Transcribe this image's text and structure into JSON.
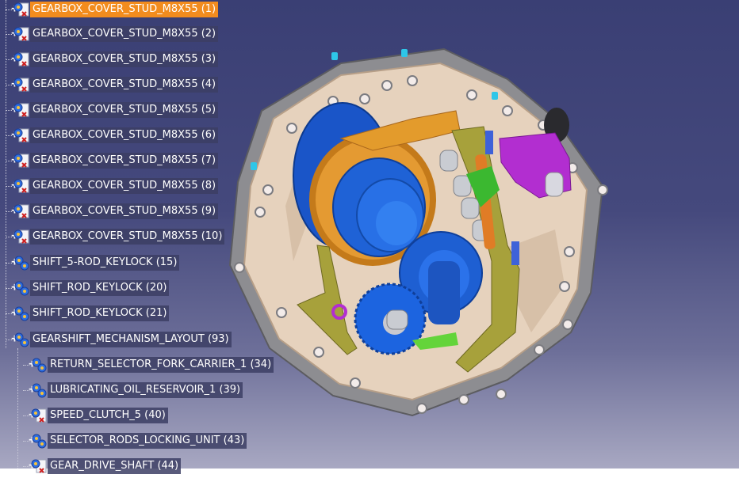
{
  "tree": {
    "items": [
      {
        "label": "GEARBOX_COVER_STUD_M8X55 (1)",
        "icon": "part-icon",
        "selected": true
      },
      {
        "label": "GEARBOX_COVER_STUD_M8X55 (2)",
        "icon": "part-icon"
      },
      {
        "label": "GEARBOX_COVER_STUD_M8X55 (3)",
        "icon": "part-icon"
      },
      {
        "label": "GEARBOX_COVER_STUD_M8X55 (4)",
        "icon": "part-icon"
      },
      {
        "label": "GEARBOX_COVER_STUD_M8X55 (5)",
        "icon": "part-icon"
      },
      {
        "label": "GEARBOX_COVER_STUD_M8X55 (6)",
        "icon": "part-icon"
      },
      {
        "label": "GEARBOX_COVER_STUD_M8X55 (7)",
        "icon": "part-icon"
      },
      {
        "label": "GEARBOX_COVER_STUD_M8X55 (8)",
        "icon": "part-icon"
      },
      {
        "label": "GEARBOX_COVER_STUD_M8X55 (9)",
        "icon": "part-icon"
      },
      {
        "label": "GEARBOX_COVER_STUD_M8X55 (10)",
        "icon": "part-icon"
      },
      {
        "label": "SHIFT_5-ROD_KEYLOCK (15)",
        "icon": "product-icon"
      },
      {
        "label": "SHIFT_ROD_KEYLOCK (20)",
        "icon": "product-icon"
      },
      {
        "label": "SHIFT_ROD_KEYLOCK (21)",
        "icon": "product-icon"
      },
      {
        "label": "GEARSHIFT_MECHANISM_LAYOUT (93)",
        "icon": "product-icon"
      },
      {
        "label": "RETURN_SELECTOR_FORK_CARRIER_1 (34)",
        "icon": "product-icon"
      },
      {
        "label": "LUBRICATING_OIL_RESERVOIR_1 (39)",
        "icon": "product-icon"
      },
      {
        "label": "SPEED_CLUTCH_5 (40)",
        "icon": "part-icon"
      },
      {
        "label": "SELECTOR_RODS_LOCKING_UNIT (43)",
        "icon": "product-icon"
      },
      {
        "label": "GEAR_DRIVE_SHAFT (44)",
        "icon": "part-icon"
      }
    ]
  },
  "colors": {
    "selection": "#f28c1e",
    "label_bg": "#3c3e64",
    "background_top": "#3a3f74",
    "background_bottom": "#a8a8c2"
  }
}
